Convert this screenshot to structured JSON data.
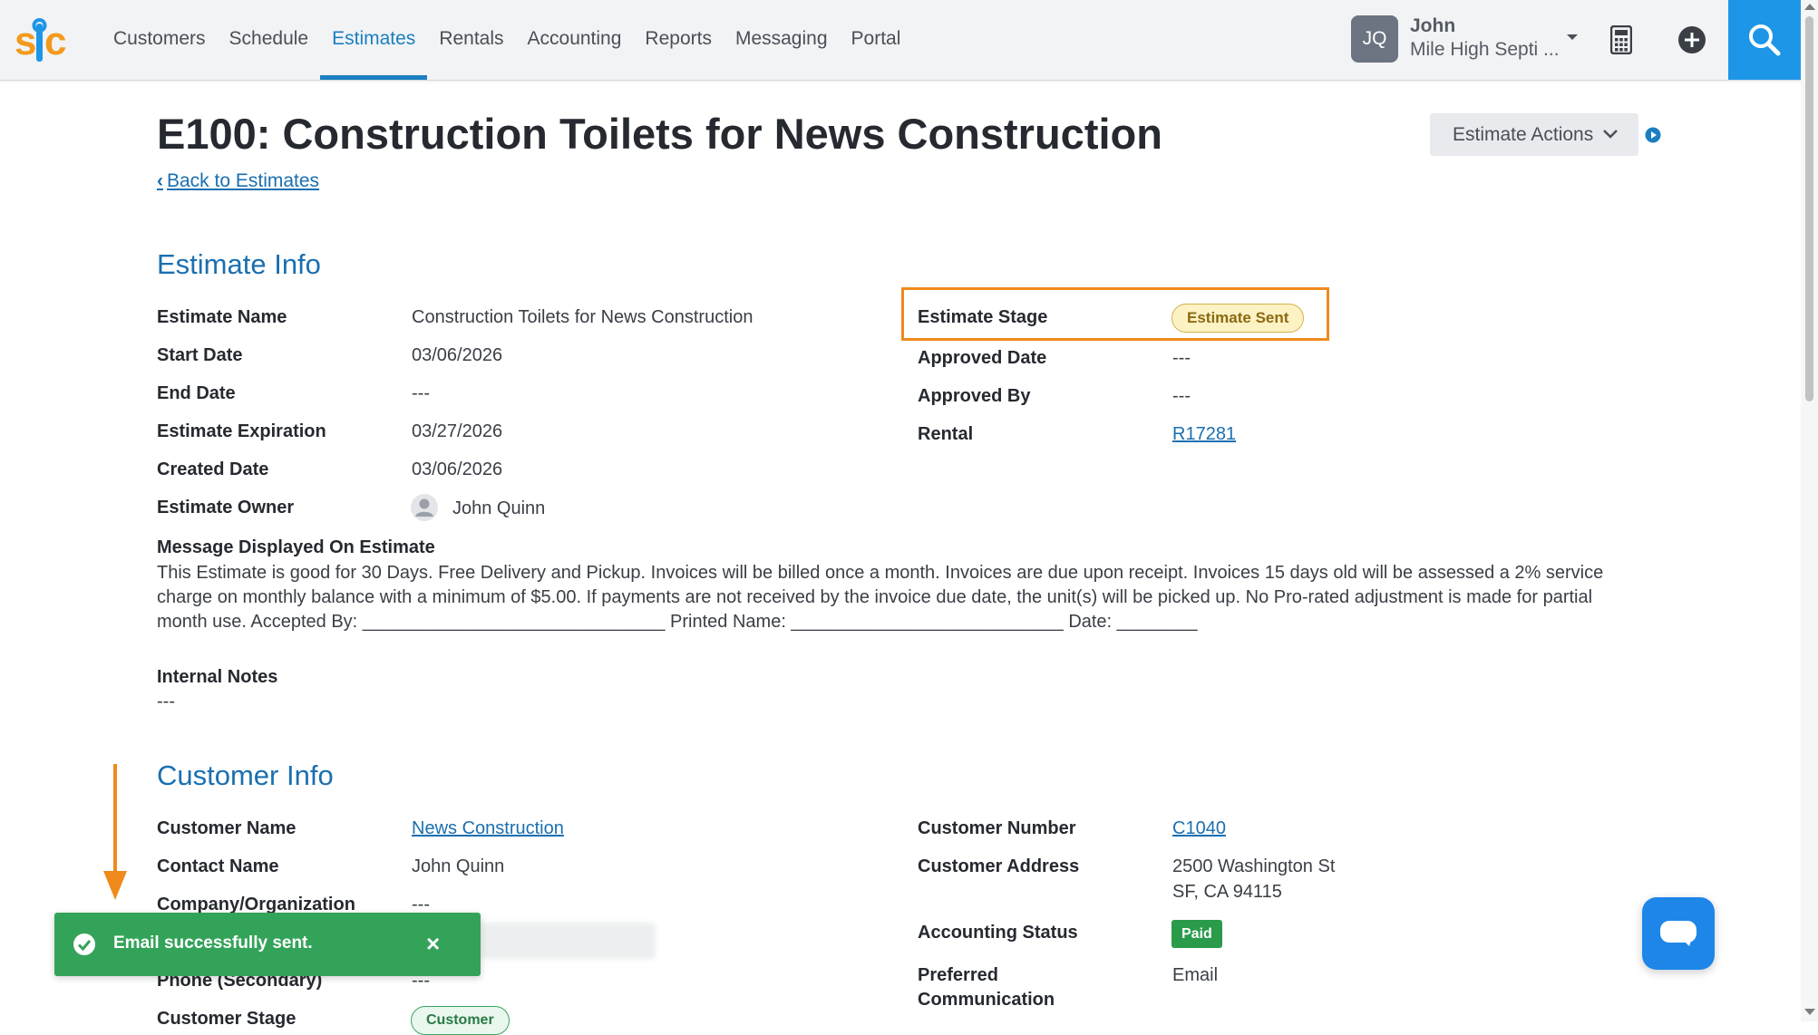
{
  "app": {
    "logo_text": "sic"
  },
  "nav": {
    "items": [
      {
        "label": "Customers"
      },
      {
        "label": "Schedule"
      },
      {
        "label": "Estimates",
        "active": true
      },
      {
        "label": "Rentals"
      },
      {
        "label": "Accounting"
      },
      {
        "label": "Reports"
      },
      {
        "label": "Messaging"
      },
      {
        "label": "Portal"
      }
    ]
  },
  "user": {
    "initials": "JQ",
    "name": "John",
    "company": "Mile High Septi ..."
  },
  "header": {
    "title": "E100: Construction Toilets for News Construction",
    "back_link": "Back to Estimates",
    "actions_label": "Estimate Actions"
  },
  "estimate_info": {
    "title": "Estimate Info",
    "left": [
      {
        "label": "Estimate Name",
        "value": "Construction Toilets for News Construction"
      },
      {
        "label": "Start Date",
        "value": "03/06/2026"
      },
      {
        "label": "End Date",
        "value": "---"
      },
      {
        "label": "Estimate Expiration",
        "value": "03/27/2026"
      },
      {
        "label": "Created Date",
        "value": "03/06/2026"
      },
      {
        "label": "Estimate Owner",
        "value": "John Quinn"
      }
    ],
    "right": [
      {
        "label": "Estimate Stage",
        "value": "Estimate Sent"
      },
      {
        "label": "Approved Date",
        "value": "---"
      },
      {
        "label": "Approved By",
        "value": "---"
      },
      {
        "label": "Rental",
        "value": "R17281"
      }
    ],
    "message_label": "Message Displayed On Estimate",
    "message": "This Estimate is good for 30 Days. Free Delivery and Pickup. Invoices will be billed once a month. Invoices are due upon receipt. Invoices 15 days old will be assessed a 2% service charge on monthly balance with a minimum of $5.00. If payments are not received by the invoice due date, the unit(s) will be picked up. No Pro-rated adjustment is made for partial month use. Accepted By: ______________________________ Printed Name: ___________________________ Date: ________",
    "internal_notes_label": "Internal Notes",
    "internal_notes": "---"
  },
  "customer_info": {
    "title": "Customer Info",
    "left": [
      {
        "label": "Customer Name",
        "value": "News Construction"
      },
      {
        "label": "Contact Name",
        "value": "John Quinn"
      },
      {
        "label": "Company/Organization",
        "value": "---"
      },
      {
        "label": "Phone (Secondary)",
        "value": "---"
      },
      {
        "label": "Customer Stage",
        "value": "Customer"
      }
    ],
    "right": [
      {
        "label": "Customer Number",
        "value": "C1040"
      },
      {
        "label": "Customer Address",
        "value_line1": "2500 Washington St",
        "value_line2": "SF, CA 94115"
      },
      {
        "label": "Accounting Status",
        "value": "Paid"
      },
      {
        "label": "Preferred",
        "label2": "Communication",
        "value": "Email"
      }
    ]
  },
  "toast": {
    "message": "Email successfully sent.",
    "close": "×"
  },
  "colors": {
    "accent": "#1a6fb0",
    "highlight": "#f08a1c",
    "success": "#33a359"
  }
}
